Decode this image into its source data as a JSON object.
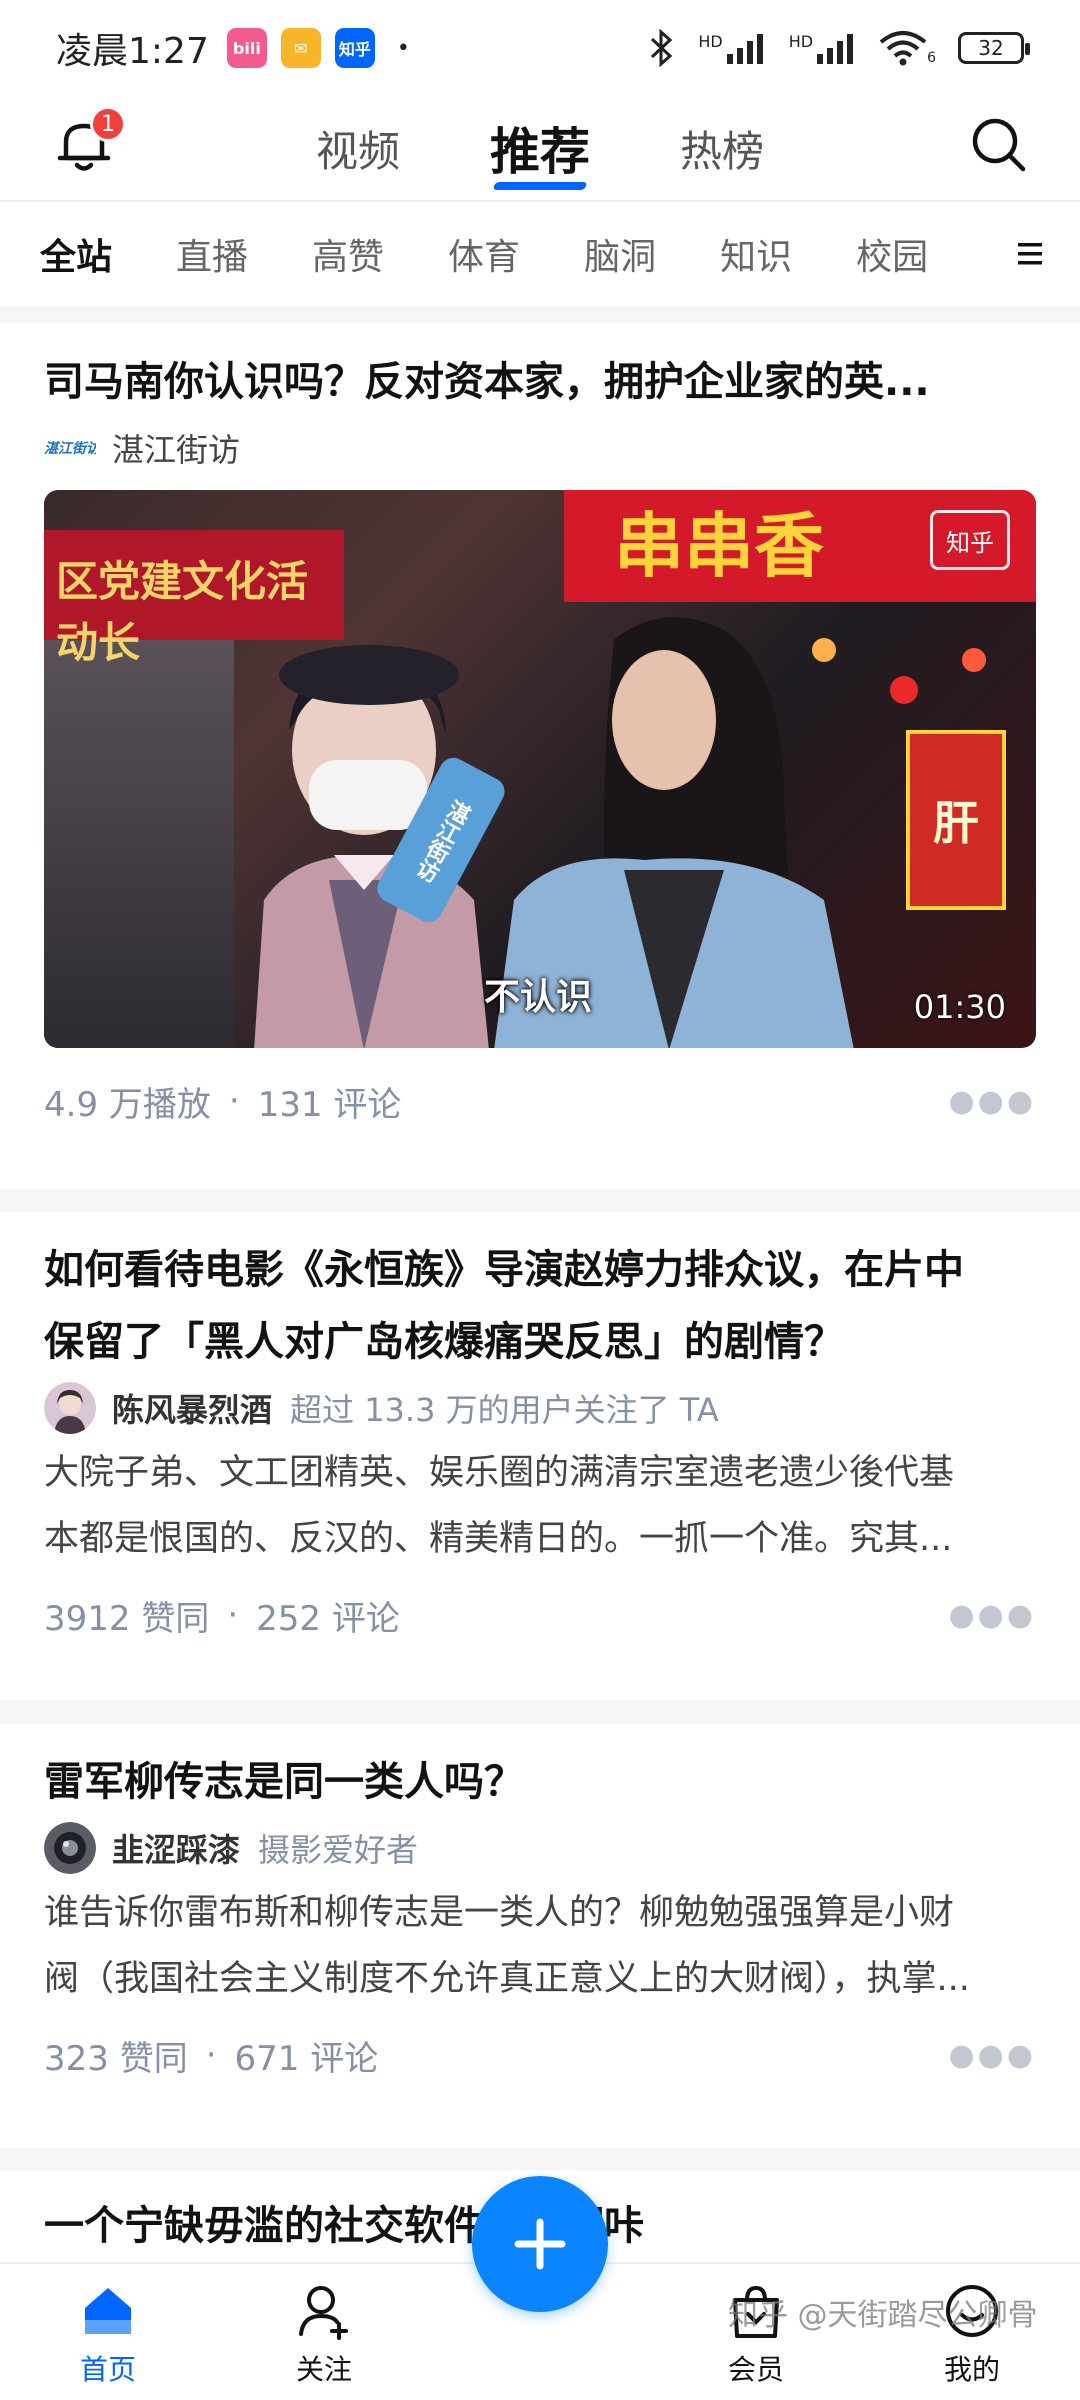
{
  "status_bar": {
    "time": "凌晨1:27",
    "app_icons": [
      {
        "name": "bilibili",
        "label": "bili",
        "color": "#f45a8d"
      },
      {
        "name": "mail",
        "label": "✉",
        "color": "#f7b529"
      },
      {
        "name": "zhihu",
        "label": "知乎",
        "color": "#0066ff"
      }
    ],
    "dot": "•",
    "signal_1": "HD",
    "signal_2": "HD",
    "wifi_sub": "6",
    "battery": "32"
  },
  "top_nav": {
    "notification_count": "1",
    "tabs": [
      {
        "label": "视频",
        "active": false
      },
      {
        "label": "推荐",
        "active": true
      },
      {
        "label": "热榜",
        "active": false
      }
    ]
  },
  "categories": [
    "全站",
    "直播",
    "高赞",
    "体育",
    "脑洞",
    "知识",
    "校园"
  ],
  "card1": {
    "title": "司马南你认识吗？反对资本家，拥护企业家的英...",
    "author": "湛江街访",
    "author_logo": "湛江街访",
    "video": {
      "banner_text": "区党建文化活动长",
      "sign_text": "串串香",
      "caption": "不认识",
      "duration": "01:30",
      "watermark_logo": "知乎",
      "mic_label": "湛江街访",
      "shop_sign": "肝"
    },
    "plays": "4.9 万播放",
    "comments": "131 评论"
  },
  "card2": {
    "title_line1": "如何看待电影《永恒族》导演赵婷力排众议，在片中",
    "title_line2": "保留了「黑人对广岛核爆痛哭反思」的剧情？",
    "author": "陈风暴烈酒",
    "author_sub": "超过 13.3 万的用户关注了 TA",
    "excerpt_line1": "大院子弟、文工团精英、娱乐圈的满清宗室遗老遗少後代基",
    "excerpt_line2": "本都是恨国的、反汉的、精美精日的。一抓一个准。究其...",
    "likes": "3912 赞同",
    "comments": "252 评论"
  },
  "card3": {
    "title": "雷军柳传志是同一类人吗？",
    "author": "韭涩踩漆",
    "author_sub": "摄影爱好者",
    "excerpt_line1": "谁告诉你雷布斯和柳传志是一类人的？柳勉勉强强算是小财",
    "excerpt_line2": "阀（我国社会主义制度不允许真正意义上的大财阀），执掌...",
    "likes": "323 赞同",
    "comments": "671 评论"
  },
  "card4": {
    "title": "一个宁缺毋滥的社交软件——翻咔"
  },
  "separator": "·",
  "bottom_nav": {
    "items": [
      {
        "label": "首页",
        "active": true
      },
      {
        "label": "关注",
        "active": false
      },
      {
        "label": "会员",
        "active": false
      },
      {
        "label": "我的",
        "active": false
      }
    ]
  },
  "watermark": "知乎 @天街踏尽公卿骨",
  "colors": {
    "accent": "#0066ff",
    "badge": "#f1403c",
    "meta": "#8590a6"
  }
}
